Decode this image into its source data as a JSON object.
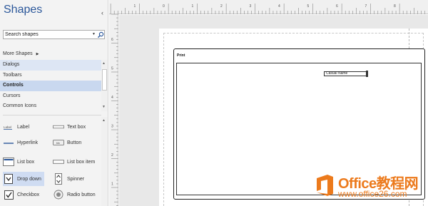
{
  "shapes_pane": {
    "title": "Shapes",
    "collapse_glyph": "‹",
    "search": {
      "placeholder": "Search shapes",
      "dropdown_glyph": "▼"
    },
    "more_shapes": {
      "label": "More Shapes",
      "arrow": "▶"
    },
    "stencils": [
      {
        "label": "Dialogs",
        "state": "highlight"
      },
      {
        "label": "Toolbars",
        "state": "normal"
      },
      {
        "label": "Controls",
        "state": "active"
      },
      {
        "label": "Cursors",
        "state": "normal"
      },
      {
        "label": "Common Icons",
        "state": "normal"
      }
    ],
    "scroll": {
      "up": "▲",
      "down": "▼"
    },
    "shapes": [
      {
        "label": "Label",
        "icon": "label-icon"
      },
      {
        "label": "Text box",
        "icon": "text-box-icon"
      },
      {
        "label": "Hyperlink",
        "icon": "hyperlink-icon"
      },
      {
        "label": "Button",
        "icon": "button-icon"
      },
      {
        "label": "List box",
        "icon": "list-box-icon"
      },
      {
        "label": "List box item",
        "icon": "list-box-item-icon"
      },
      {
        "label": "Drop down",
        "icon": "drop-down-icon",
        "selected": true
      },
      {
        "label": "Spinner",
        "icon": "spinner-icon"
      },
      {
        "label": "Checkbox",
        "icon": "checkbox-icon"
      },
      {
        "label": "Radio button",
        "icon": "radio-button-icon"
      }
    ],
    "icon_text": {
      "label": "Label",
      "button": "btn"
    }
  },
  "rulers": {
    "top_numbers": [
      "2",
      "1",
      "0",
      "1",
      "2",
      "3",
      "4",
      "5",
      "6",
      "7",
      "8"
    ],
    "left_numbers": [
      "6",
      "5",
      "4",
      "3",
      "2",
      "1"
    ]
  },
  "canvas": {
    "dialog": {
      "title": "Print",
      "textbox_text": "Casual Name"
    }
  },
  "watermark": {
    "brand": "Office教程网",
    "url": "www.office26.com"
  },
  "colors": {
    "accent": "#2b579a",
    "watermark": "#ec7a1c",
    "selection": "#c9d8ef"
  }
}
